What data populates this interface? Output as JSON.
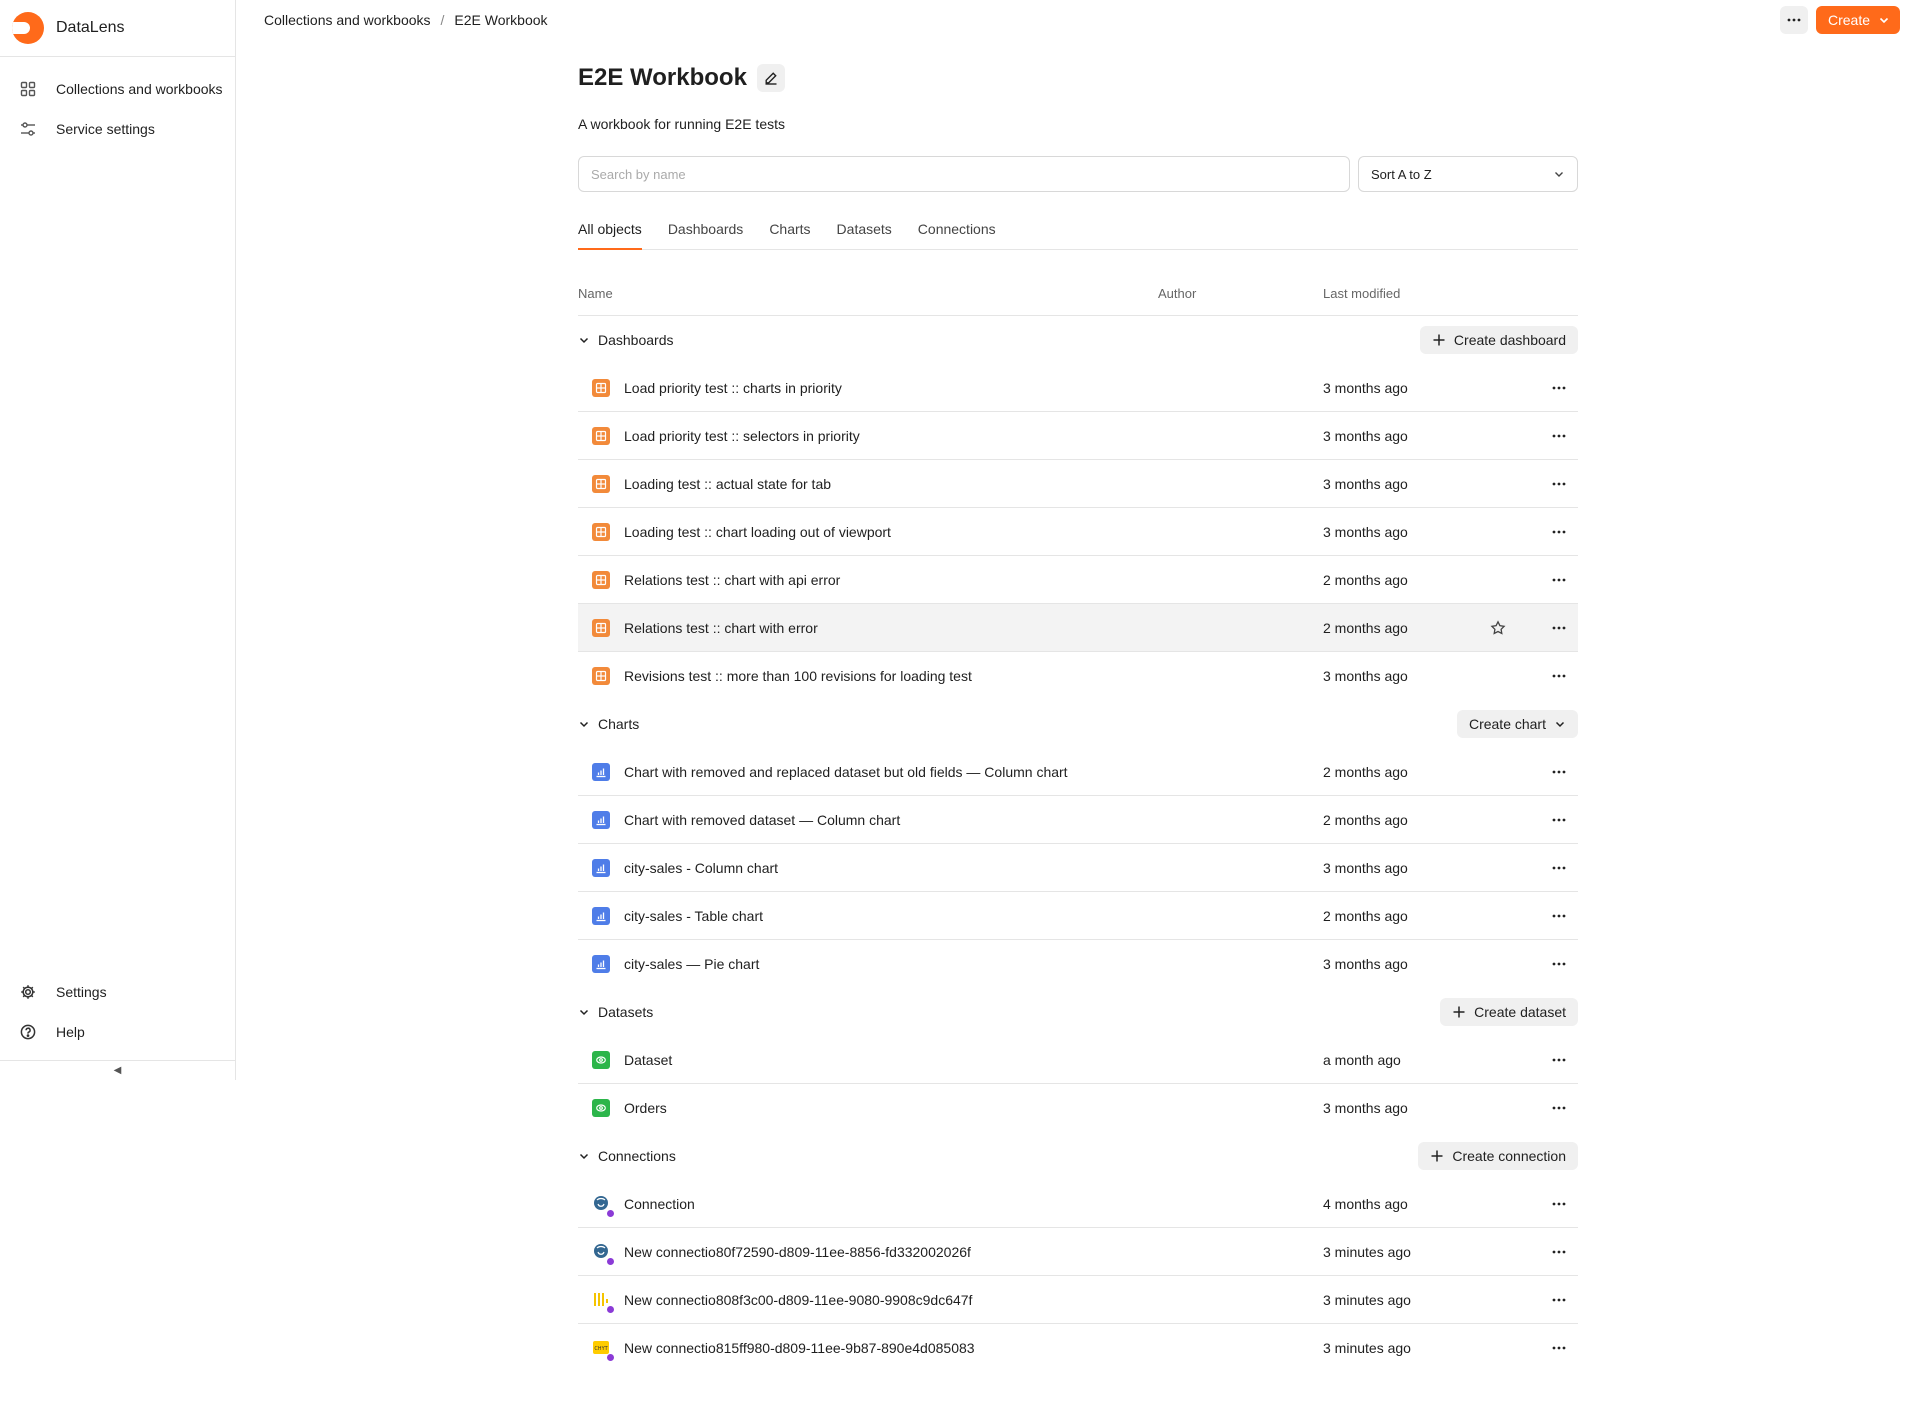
{
  "app": {
    "name": "DataLens"
  },
  "sidebar": {
    "items": [
      {
        "label": "Collections and workbooks",
        "icon": "grid-icon"
      },
      {
        "label": "Service settings",
        "icon": "sliders-icon"
      }
    ],
    "bottom": [
      {
        "label": "Settings",
        "icon": "gear-icon"
      },
      {
        "label": "Help",
        "icon": "help-circle-icon"
      }
    ],
    "collapse_glyph": "◀"
  },
  "breadcrumbs": {
    "root": "Collections and workbooks",
    "current": "E2E Workbook"
  },
  "header": {
    "create_label": "Create"
  },
  "workbook": {
    "title": "E2E Workbook",
    "description": "A workbook for running E2E tests"
  },
  "search": {
    "placeholder": "Search by name",
    "value": ""
  },
  "sort": {
    "selected": "Sort A to Z"
  },
  "tabs": [
    "All objects",
    "Dashboards",
    "Charts",
    "Datasets",
    "Connections"
  ],
  "table": {
    "col_name": "Name",
    "col_author": "Author",
    "col_modified": "Last modified"
  },
  "groups": {
    "dashboards": {
      "label": "Dashboards",
      "action": "Create dashboard",
      "rows": [
        {
          "name": "Load priority test :: charts in priority",
          "modified": "3 months ago"
        },
        {
          "name": "Load priority test :: selectors in priority",
          "modified": "3 months ago"
        },
        {
          "name": "Loading test :: actual state for tab",
          "modified": "3 months ago"
        },
        {
          "name": "Loading test :: chart loading out of viewport",
          "modified": "3 months ago"
        },
        {
          "name": "Relations test :: chart with api error",
          "modified": "2 months ago"
        },
        {
          "name": "Relations test :: chart with error",
          "modified": "2 months ago"
        },
        {
          "name": "Revisions test :: more than 100 revisions for loading test",
          "modified": "3 months ago"
        }
      ]
    },
    "charts": {
      "label": "Charts",
      "action": "Create chart",
      "rows": [
        {
          "name": "Chart with removed and replaced dataset but old fields — Column chart",
          "modified": "2 months ago"
        },
        {
          "name": "Chart with removed dataset — Column chart",
          "modified": "2 months ago"
        },
        {
          "name": "city-sales - Column chart",
          "modified": "3 months ago"
        },
        {
          "name": "city-sales - Table chart",
          "modified": "2 months ago"
        },
        {
          "name": "city-sales — Pie chart",
          "modified": "3 months ago"
        }
      ]
    },
    "datasets": {
      "label": "Datasets",
      "action": "Create dataset",
      "rows": [
        {
          "name": "Dataset",
          "modified": "a month ago"
        },
        {
          "name": "Orders",
          "modified": "3 months ago"
        }
      ]
    },
    "connections": {
      "label": "Connections",
      "action": "Create connection",
      "rows": [
        {
          "name": "Connection",
          "modified": "4 months ago"
        },
        {
          "name": "New connectio80f72590-d809-11ee-8856-fd332002026f",
          "modified": "3 minutes ago"
        },
        {
          "name": "New connectio808f3c00-d809-11ee-9080-9908c9dc647f",
          "modified": "3 minutes ago"
        },
        {
          "name": "New connectio815ff980-d809-11ee-9b87-890e4d085083",
          "modified": "3 minutes ago"
        }
      ]
    }
  },
  "colors": {
    "accent": "#ff6a1a",
    "dashboard": "#f28a3a",
    "chart": "#4f7de8",
    "dataset": "#2cb54a"
  }
}
